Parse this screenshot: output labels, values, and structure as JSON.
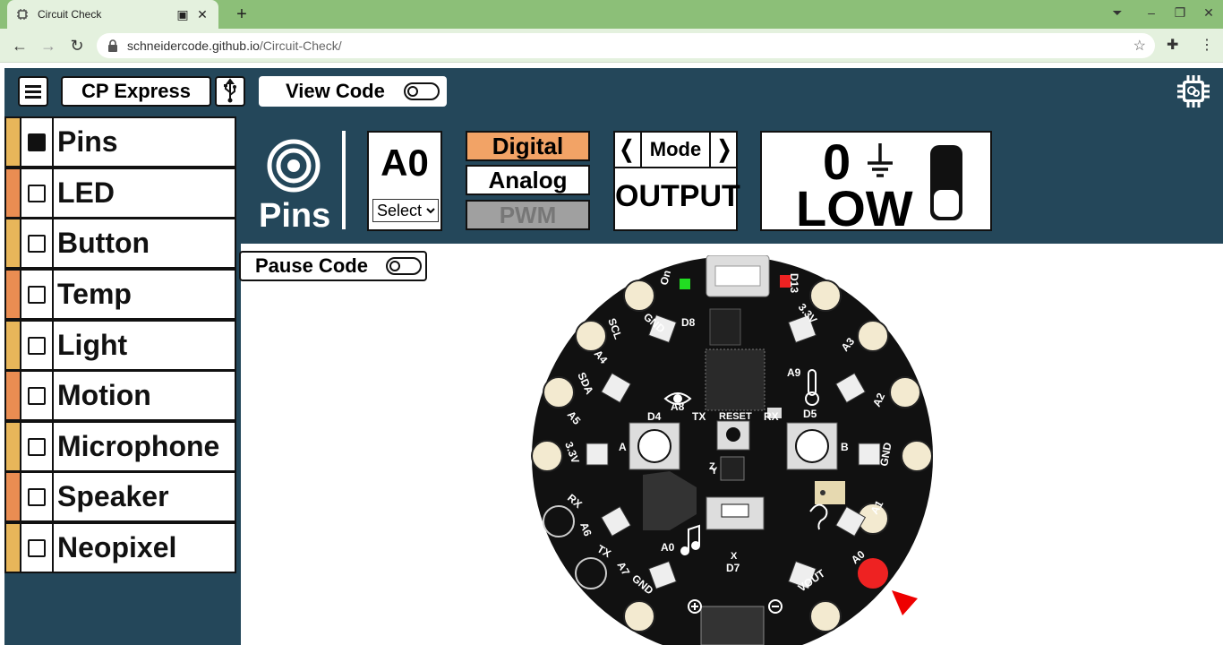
{
  "browser": {
    "tab_title": "Circuit Check",
    "url_host": "schneidercode.github.io",
    "url_path": "/Circuit-Check/"
  },
  "app": {
    "board_name": "CP Express",
    "view_code_label": "View Code",
    "pause_code_label": "Pause Code",
    "sidebar": [
      {
        "label": "Pins",
        "checked": true,
        "color": "#e8b65a"
      },
      {
        "label": "LED",
        "checked": false,
        "color": "#ea8d52"
      },
      {
        "label": "Button",
        "checked": false,
        "color": "#e8b65a"
      },
      {
        "label": "Temp",
        "checked": false,
        "color": "#ea8d52"
      },
      {
        "label": "Light",
        "checked": false,
        "color": "#e8b65a"
      },
      {
        "label": "Motion",
        "checked": false,
        "color": "#ea8d52"
      },
      {
        "label": "Microphone",
        "checked": false,
        "color": "#e8b65a"
      },
      {
        "label": "Speaker",
        "checked": false,
        "color": "#ea8d52"
      },
      {
        "label": "Neopixel",
        "checked": false,
        "color": "#e8b65a"
      }
    ],
    "pins": {
      "title": "Pins",
      "pin": "A0",
      "select_option": "Select",
      "modes": [
        "Digital",
        "Analog",
        "PWM"
      ],
      "active_mode": "Digital",
      "mode_label": "Mode",
      "direction": "OUTPUT",
      "value": "0",
      "level": "LOW"
    },
    "colors": {
      "panel": "#24475a",
      "active": "#f2a366",
      "disabled": "#a0a0a0",
      "led_green": "#22dd22",
      "led_red": "#ee2222"
    },
    "board_labels": {
      "on": "On",
      "d13": "D13",
      "gnd": "GND",
      "d8": "D8",
      "v33": "3.3V",
      "scl": "SCL",
      "a4": "A4",
      "a9": "A9",
      "a3": "A3",
      "sda": "SDA",
      "a5": "A5",
      "a8": "A8",
      "a2": "A2",
      "d4": "D4",
      "tx": "TX",
      "reset": "RESET",
      "rx": "RX",
      "d5": "D5",
      "btn_a": "A",
      "btn_b": "B",
      "a6": "A6",
      "a7": "A7",
      "a1": "A1",
      "a0": "A0",
      "d7": "D7",
      "vout": "VOUT",
      "ax_x": "X",
      "ax_y": "Y",
      "ax_z": "Z"
    }
  }
}
